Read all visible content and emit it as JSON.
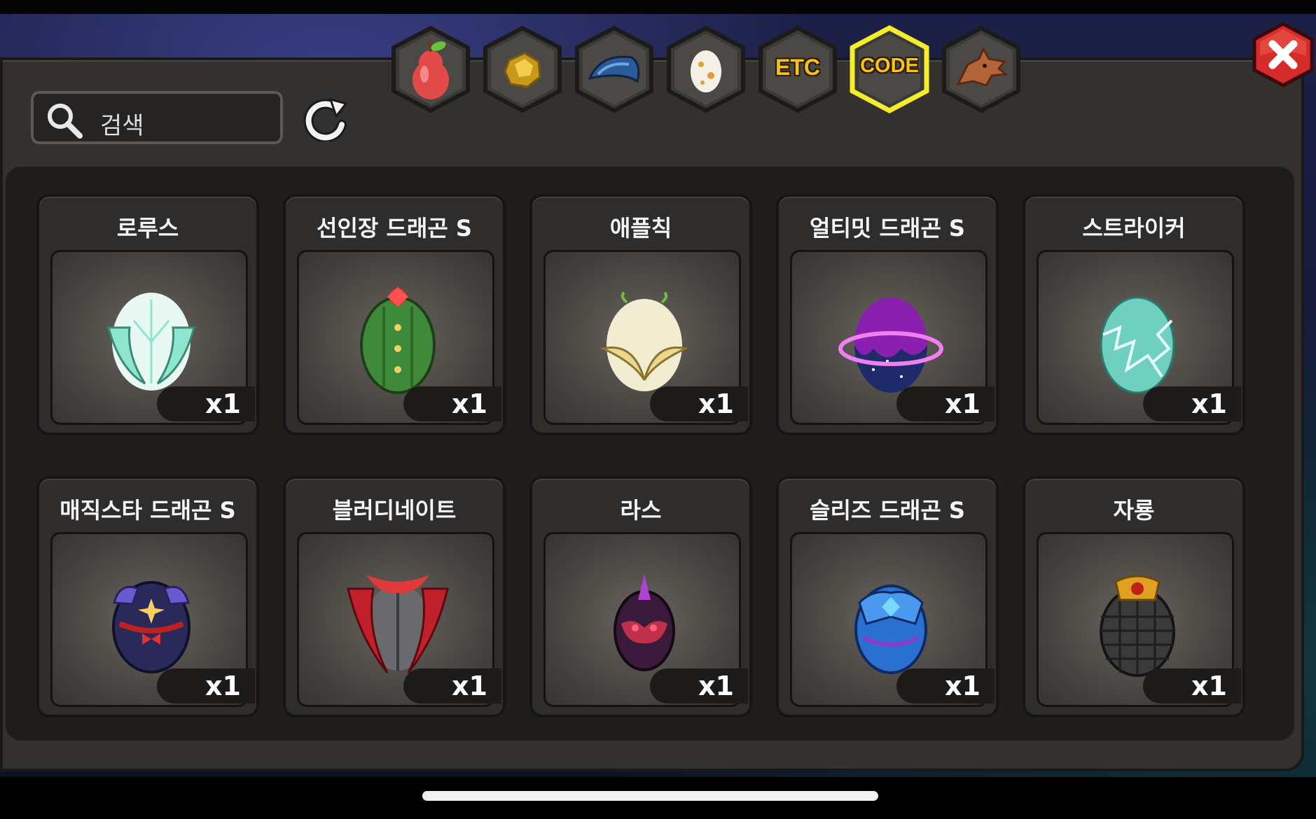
{
  "search": {
    "placeholder": "검색"
  },
  "tabs": [
    {
      "name": "fruit",
      "icon": "pear-icon",
      "label": ""
    },
    {
      "name": "gold",
      "icon": "gold-ore-icon",
      "label": ""
    },
    {
      "name": "dragon-part",
      "icon": "dragon-scale-icon",
      "label": ""
    },
    {
      "name": "egg",
      "icon": "egg-icon",
      "label": ""
    },
    {
      "name": "etc",
      "icon": "",
      "label": "ETC"
    },
    {
      "name": "code",
      "icon": "",
      "label": "CODE",
      "active": true
    },
    {
      "name": "dragon",
      "icon": "dragon-head-icon",
      "label": ""
    }
  ],
  "items": [
    {
      "name": "로루스",
      "count": "x1",
      "icon": "white-winged-egg-icon",
      "color": "#8fe6cf"
    },
    {
      "name": "선인장 드래곤 S",
      "count": "x1",
      "icon": "cactus-egg-icon",
      "color": "#3f8a3a"
    },
    {
      "name": "애플칙",
      "count": "x1",
      "icon": "golden-winged-egg-icon",
      "color": "#e8dca0"
    },
    {
      "name": "얼티밋 드래곤 S",
      "count": "x1",
      "icon": "purple-planet-egg-icon",
      "color": "#8a1fb0"
    },
    {
      "name": "스트라이커",
      "count": "x1",
      "icon": "lightning-egg-icon",
      "color": "#6fd0c0"
    },
    {
      "name": "매직스타 드래곤 S",
      "count": "x1",
      "icon": "magic-star-egg-icon",
      "color": "#2a2a5a"
    },
    {
      "name": "블러디네이트",
      "count": "x1",
      "icon": "bloody-egg-icon",
      "color": "#c0202a"
    },
    {
      "name": "라스",
      "count": "x1",
      "icon": "dark-spike-egg-icon",
      "color": "#5a1a3a"
    },
    {
      "name": "슬리즈 드래곤 S",
      "count": "x1",
      "icon": "blue-armor-egg-icon",
      "color": "#2a70d0"
    },
    {
      "name": "자룡",
      "count": "x1",
      "icon": "armored-black-egg-icon",
      "color": "#3a3a3a"
    }
  ]
}
